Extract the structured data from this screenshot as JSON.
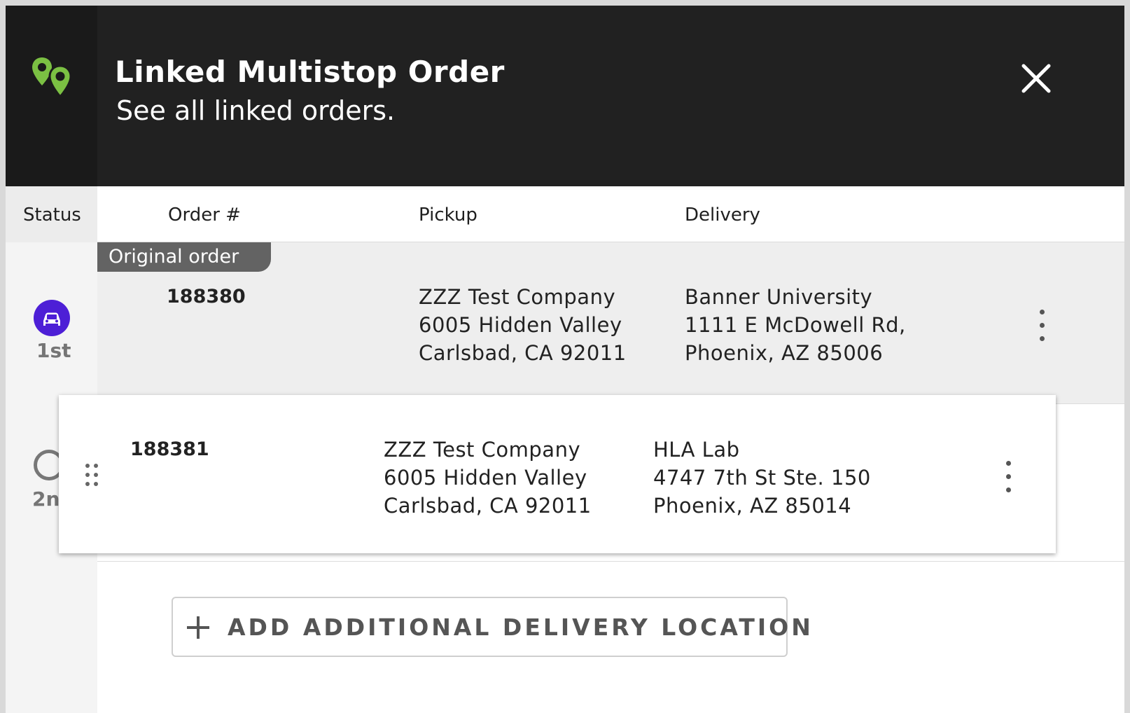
{
  "header": {
    "title": "Linked Multistop Order",
    "subtitle": "See all linked orders.",
    "icon": "map-pins-icon",
    "accent_color": "#7bc043"
  },
  "table": {
    "columns": {
      "status": "Status",
      "order": "Order #",
      "pickup": "Pickup",
      "delivery": "Delivery"
    },
    "rows": [
      {
        "tag": "Original order",
        "status_label": "1st",
        "status_icon": "car-icon",
        "status_color": "#4d1fd6",
        "order_number": "188380",
        "pickup": [
          "ZZZ Test Company",
          "6005 Hidden Valley",
          "Carlsbad, CA 92011"
        ],
        "delivery": [
          "Banner University",
          "1111 E McDowell Rd,",
          "Phoenix, AZ 85006"
        ]
      },
      {
        "status_label": "2n",
        "status_icon": "pending-ring-icon",
        "order_number": "188381",
        "pickup": [
          "ZZZ Test Company",
          "6005 Hidden Valley",
          "Carlsbad, CA 92011"
        ],
        "delivery": [
          "HLA Lab",
          "4747 7th St Ste. 150",
          "Phoenix, AZ 85014"
        ]
      }
    ]
  },
  "add_button": {
    "label": "ADD ADDITIONAL DELIVERY LOCATION",
    "icon": "plus-icon"
  }
}
